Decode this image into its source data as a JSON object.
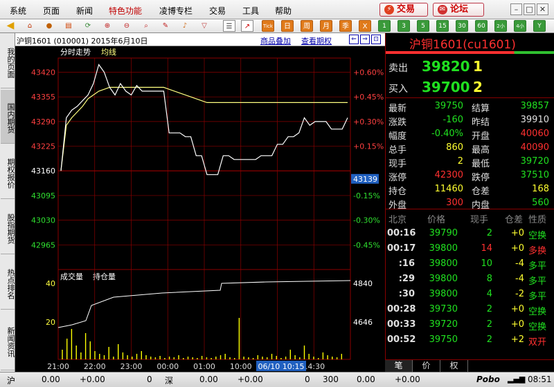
{
  "menubar": {
    "items": [
      "系统",
      "页面",
      "新闻",
      "特色功能",
      "凌博专栏",
      "交易",
      "工具",
      "帮助"
    ],
    "trade_btn": "交易",
    "forum_btn": "论坛"
  },
  "toolbar": {
    "period_buttons": [
      "日",
      "周",
      "月",
      "季",
      "1",
      "3",
      "5",
      "15",
      "30",
      "60",
      "2小时",
      "4小时",
      "Y"
    ],
    "tick_label": "Tick"
  },
  "left_tabs": [
    "我的页面",
    "国内期货",
    "期权报价",
    "股指期货",
    "热点排名",
    "新闻资讯"
  ],
  "chart": {
    "contract_info": "沪铜1601 (010001) 2015年6月10日",
    "link_overlay": "商品叠加",
    "link_option": "查看期权",
    "label_timeshare": "分时走势",
    "label_avg": "均线",
    "label_volume": "成交量",
    "label_oi": "持仓量",
    "current_price_tag": "43139",
    "time_cursor": "06/10 10:15",
    "colors": {
      "price_up": "#ff4040",
      "price_down": "#30e030",
      "grid": "#8b0000",
      "price_line": "#ffffff",
      "avg_line": "#ffff80",
      "volume": "#ffff00"
    }
  },
  "chart_data": {
    "type": "line",
    "price_ticks_left": [
      "43420",
      "43355",
      "43290",
      "43225",
      "43160",
      "43095",
      "43030",
      "42965"
    ],
    "pct_ticks_right": [
      "+0.60%",
      "+0.45%",
      "+0.30%",
      "+0.15%",
      "0",
      "-0.15%",
      "-0.30%",
      "-0.45%"
    ],
    "baseline": 43160,
    "ylim": [
      42900,
      43450
    ],
    "x_ticks": [
      "21:00",
      "22:00",
      "23:00",
      "00:00",
      "01:00",
      "10:00",
      "14:30"
    ],
    "series": [
      {
        "values": [
          43160,
          43300,
          43320,
          43330,
          43345,
          43360,
          43390,
          43440,
          43420,
          43380,
          43360,
          43390,
          43370,
          43360,
          43385,
          43370,
          43370,
          43370,
          43370,
          43370,
          43260,
          43260,
          43260,
          43250,
          43250,
          43200,
          43200,
          43150,
          43150,
          43150,
          43200,
          43200,
          43190,
          43190,
          43190,
          43190,
          43190,
          43200,
          43200,
          43200,
          43230,
          43230,
          43250,
          43250,
          43260,
          43300,
          43280,
          43290,
          43290,
          43290,
          43270,
          43270,
          43270,
          43300
        ]
      },
      {
        "values": [
          43160,
          43280,
          43300,
          43315,
          43330,
          43350,
          43360,
          43370,
          43375,
          43380,
          43380,
          43380,
          43380,
          43380,
          43380,
          43380,
          43380,
          43380,
          43380,
          43380,
          43375,
          43370,
          43365,
          43360,
          43355,
          43350,
          43345,
          43340,
          43340,
          43340,
          43340,
          43340,
          43340,
          43340,
          43340,
          43340,
          43340,
          43340,
          43340,
          43340,
          43340,
          43340,
          43340,
          43340,
          43340,
          43340,
          43340,
          43340,
          43340,
          43340,
          43340,
          43340,
          43340,
          43340
        ]
      }
    ],
    "volume_ticks_left": [
      "40",
      "20"
    ],
    "oi_ticks_right": [
      "4840",
      "4646"
    ]
  },
  "quote": {
    "title": "沪铜1601(cu1601)",
    "sell_label": "卖出",
    "sell_price": "39820",
    "sell_vol": "1",
    "buy_label": "买入",
    "buy_price": "39700",
    "buy_vol": "2",
    "rows": [
      [
        "最新",
        "39750",
        "结算",
        "39857"
      ],
      [
        "涨跌",
        "-160",
        "昨结",
        "39910"
      ],
      [
        "幅度",
        "-0.40%",
        "开盘",
        "40060"
      ],
      [
        "总手",
        "860",
        "最高",
        "40090"
      ],
      [
        "现手",
        "2",
        "最低",
        "39720"
      ],
      [
        "涨停",
        "42300",
        "跌停",
        "37510"
      ],
      [
        "持仓",
        "11460",
        "仓差",
        "168"
      ],
      [
        "外盘",
        "300",
        "内盘",
        "560"
      ]
    ],
    "ticks_header": [
      "北京",
      "价格",
      "现手",
      "仓差",
      "性质"
    ],
    "ticks": [
      [
        "00:16",
        "39790",
        "2",
        "+0",
        "空换"
      ],
      [
        "00:17",
        "39800",
        "14",
        "+0",
        "多换"
      ],
      [
        ":16",
        "39800",
        "10",
        "-4",
        "多平"
      ],
      [
        ":29",
        "39800",
        "8",
        "-4",
        "多平"
      ],
      [
        ":30",
        "39800",
        "4",
        "-2",
        "多平"
      ],
      [
        "00:28",
        "39730",
        "2",
        "+0",
        "空换"
      ],
      [
        "00:33",
        "39720",
        "2",
        "+0",
        "空换"
      ],
      [
        "00:52",
        "39750",
        "2",
        "+2",
        "双开"
      ]
    ],
    "bottom_tabs": [
      "笔",
      "价",
      "权"
    ]
  },
  "status": {
    "sh_label": "沪",
    "sh_v1": "0.00",
    "sh_v2": "+0.00",
    "sh_v3": "0",
    "sz_label": "深",
    "sz_v1": "0.00",
    "sz_v2": "+0.00",
    "sz_v3": "0",
    "v4": "300",
    "v5": "0.00",
    "v6": "+0.00",
    "brand": "Pobo",
    "time": "08:51"
  }
}
